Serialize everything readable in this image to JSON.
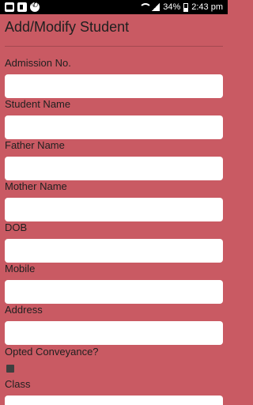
{
  "status_bar": {
    "battery": "34%",
    "time": "2:43 pm"
  },
  "form": {
    "title": "Add/Modify Student",
    "fields": {
      "admission": {
        "label": "Admission No.",
        "value": ""
      },
      "student_name": {
        "label": "Student Name",
        "value": ""
      },
      "father_name": {
        "label": "Father Name",
        "value": ""
      },
      "mother_name": {
        "label": "Mother Name",
        "value": ""
      },
      "dob": {
        "label": "DOB",
        "value": ""
      },
      "mobile": {
        "label": "Mobile",
        "value": ""
      },
      "address": {
        "label": "Address",
        "value": ""
      },
      "conveyance": {
        "label": "Opted Conveyance?",
        "checked": false
      },
      "class": {
        "label": "Class",
        "value": ""
      }
    }
  }
}
